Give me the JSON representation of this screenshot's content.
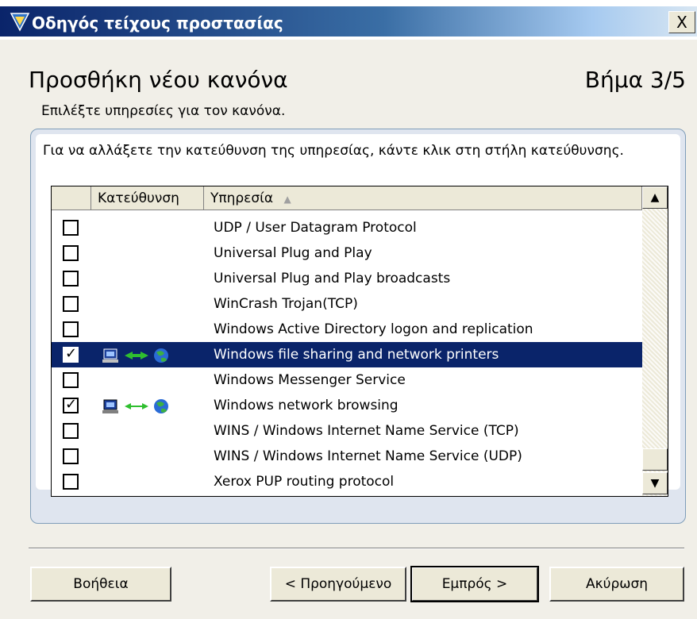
{
  "window": {
    "title": "Οδηγός τείχους προστασίας",
    "close_label": "X"
  },
  "header": {
    "heading": "Προσθήκη νέου κανόνα",
    "step": "Βήμα 3/5",
    "subheading": "Επιλέξτε υπηρεσίες για τον κανόνα."
  },
  "panel": {
    "instruction": "Για να αλλάξετε την κατεύθυνση της υπηρεσίας, κάντε κλικ στη στήλη κατεύθυνσης."
  },
  "table": {
    "columns": {
      "checkbox": "",
      "direction": "Κατεύθυνση",
      "service": "Υπηρεσία",
      "sort_indicator": "▲"
    },
    "rows": [
      {
        "checked": false,
        "direction": "",
        "service": "UDP / User Datagram Protocol"
      },
      {
        "checked": false,
        "direction": "",
        "service": "Universal Plug and Play"
      },
      {
        "checked": false,
        "direction": "",
        "service": "Universal Plug and Play broadcasts"
      },
      {
        "checked": false,
        "direction": "",
        "service": "WinCrash Trojan(TCP)"
      },
      {
        "checked": false,
        "direction": "",
        "service": "Windows Active Directory logon and replication"
      },
      {
        "checked": true,
        "direction": "both",
        "service": "Windows file sharing and network printers",
        "selected": true
      },
      {
        "checked": false,
        "direction": "",
        "service": "Windows Messenger Service"
      },
      {
        "checked": true,
        "direction": "both",
        "service": "Windows network browsing"
      },
      {
        "checked": false,
        "direction": "",
        "service": "WINS / Windows Internet Name Service (TCP)"
      },
      {
        "checked": false,
        "direction": "",
        "service": "WINS / Windows Internet Name Service (UDP)"
      },
      {
        "checked": false,
        "direction": "",
        "service": "Xerox PUP routing protocol"
      }
    ],
    "icons": {
      "direction_icons": [
        "computer-icon",
        "bidirectional-arrow-icon",
        "globe-icon"
      ]
    }
  },
  "buttons": {
    "help": "Βοήθεια",
    "back": "< Προηγούμενο",
    "next": "Εμπρός >",
    "cancel": "Ακύρωση"
  },
  "colors": {
    "selection": "#0a246a",
    "titlebar_start": "#0a246a",
    "panel_border": "#7f9db9"
  }
}
